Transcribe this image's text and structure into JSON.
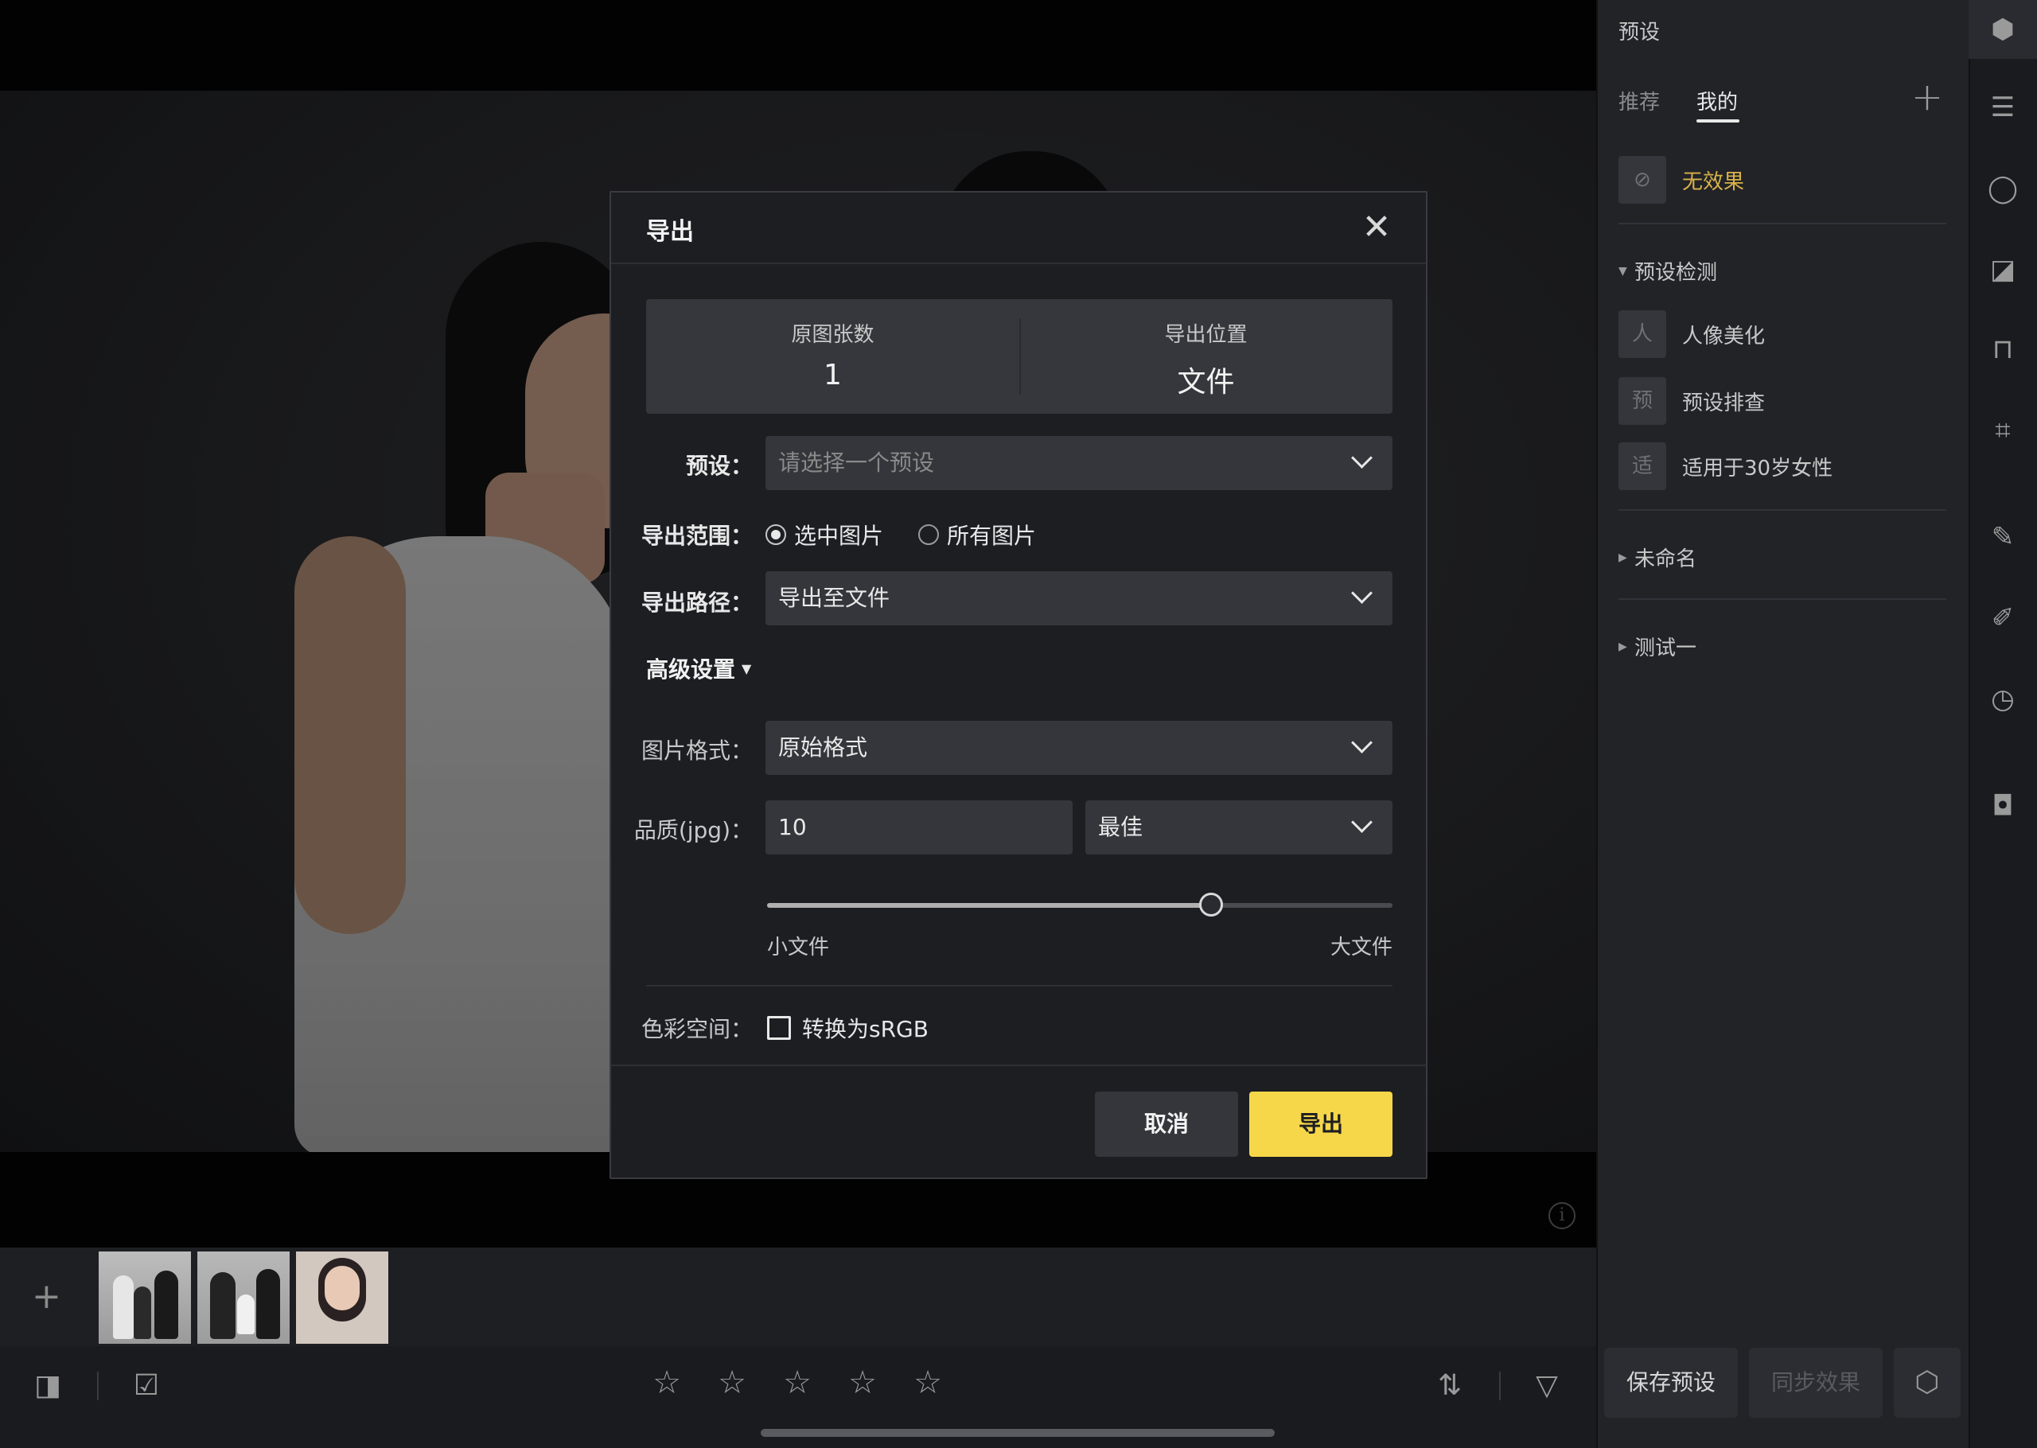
{
  "colors": {
    "accent": "#f6d74a",
    "preset_active": "#d8b24a",
    "panel_bg": "#222327",
    "modal_bg": "#1d1e22"
  },
  "right_panel": {
    "title": "预设",
    "tabs": [
      {
        "label": "推荐"
      },
      {
        "label": "我的",
        "active": true
      }
    ],
    "add_icon": "plus-icon",
    "none_preset": {
      "icon": "circle-slash-icon",
      "label": "无效果"
    },
    "groups": [
      {
        "label": "预设检测",
        "expanded": true,
        "items": [
          {
            "badge": "人",
            "label": "人像美化"
          },
          {
            "badge": "预",
            "label": "预设排查"
          },
          {
            "badge": "适",
            "label": "适用于30岁女性"
          }
        ]
      },
      {
        "label": "未命名",
        "expanded": false
      },
      {
        "label": "测试一",
        "expanded": false
      }
    ],
    "buttons": {
      "save": "保存预设",
      "sync": "同步效果",
      "settings_icon": "hexagon-gear-icon"
    }
  },
  "icon_bar": [
    "cube-icon",
    "sliders-icon",
    "face-icon",
    "image-adjust-icon",
    "shirt-icon",
    "crop-icon",
    "brush-icon",
    "pencil-icon",
    "history-icon",
    "camera-icon"
  ],
  "filmstrip": {
    "add_icon": "plus-icon",
    "thumbnails": [
      {
        "name": "thumb-1",
        "selected": true
      },
      {
        "name": "thumb-2",
        "selected": false
      },
      {
        "name": "thumb-3",
        "selected": false
      }
    ]
  },
  "bottom_toolbar": {
    "left_icons": [
      "compare-icon",
      "select-all-icon"
    ],
    "rating": {
      "stars": 5,
      "value": 0
    },
    "right_icons": [
      "sort-icon",
      "filter-icon"
    ]
  },
  "canvas": {
    "info_icon": "info-icon"
  },
  "export_dialog": {
    "title": "导出",
    "close_icon": "close-icon",
    "stats": [
      {
        "label": "原图张数",
        "value": "1"
      },
      {
        "label": "导出位置",
        "value": "文件"
      }
    ],
    "preset": {
      "label": "预设：",
      "placeholder": "请选择一个预设"
    },
    "range": {
      "label": "导出范围：",
      "options": [
        {
          "label": "选中图片",
          "checked": true
        },
        {
          "label": "所有图片",
          "checked": false
        }
      ]
    },
    "path": {
      "label": "导出路径：",
      "value": "导出至文件"
    },
    "advanced": {
      "label": "高级设置"
    },
    "format": {
      "label": "图片格式：",
      "value": "原始格式"
    },
    "quality": {
      "label": "品质(jpg)：",
      "value": "10",
      "preset": "最佳",
      "slider": {
        "min_label": "小文件",
        "max_label": "大文件",
        "fraction": 0.71
      }
    },
    "color_space": {
      "label": "色彩空间：",
      "checkbox_label": "转换为sRGB",
      "checked": false
    },
    "buttons": {
      "cancel": "取消",
      "export": "导出"
    }
  }
}
